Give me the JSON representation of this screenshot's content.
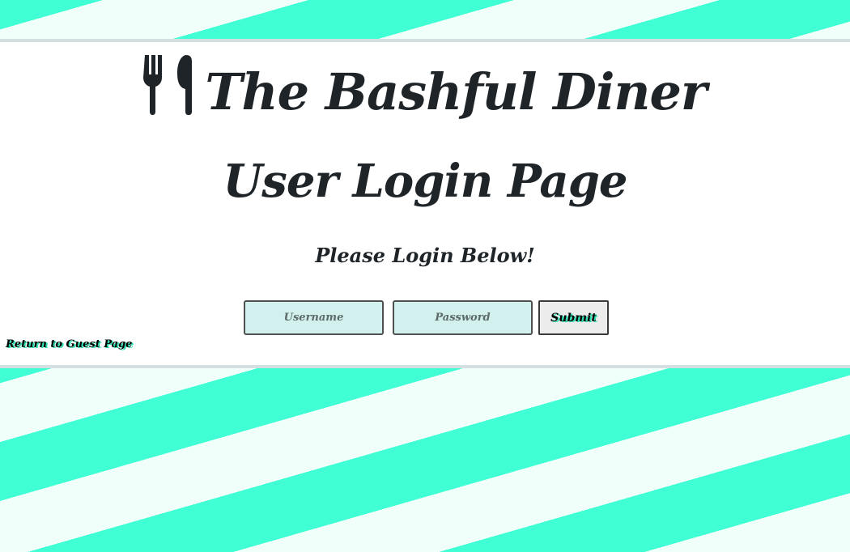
{
  "header": {
    "site_title": "The Bashful Diner",
    "icon": "utensils-icon"
  },
  "main": {
    "page_title": "User Login Page",
    "prompt": "Please Login Below!"
  },
  "login_form": {
    "username_placeholder": "Username",
    "username_value": "",
    "password_placeholder": "Password",
    "password_value": "",
    "submit_label": "Submit"
  },
  "links": {
    "return_label": "Return to Guest Page"
  },
  "colors": {
    "stripe_light": "#f0fffa",
    "stripe_accent": "#40ffd5",
    "panel_border": "#d4dfe2",
    "text_dark": "#1e2428",
    "input_bg": "#d2f0ed",
    "text_shadow_accent": "#2de0b3"
  }
}
